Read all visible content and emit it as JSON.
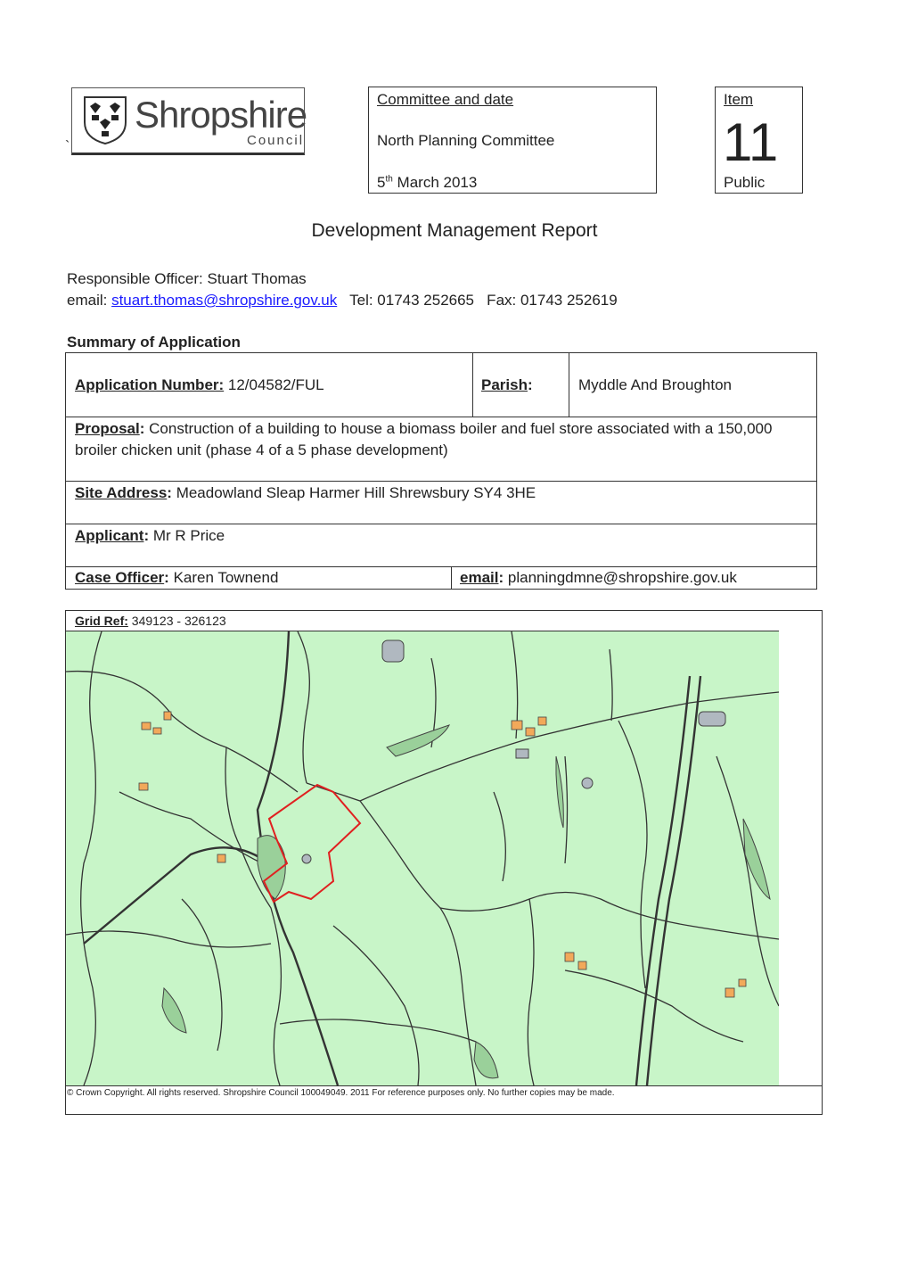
{
  "header": {
    "logo_word": "Shropshire",
    "logo_sub": "Council",
    "backtick": "`",
    "committee_label": "Committee and date",
    "committee_name": "North Planning Committee",
    "date_day": "5",
    "date_suffix": "th",
    "date_rest": " March 2013",
    "item_label": "Item",
    "item_number": "11",
    "item_status": "Public"
  },
  "report_title": "Development Management Report",
  "officer": {
    "line": "Responsible Officer: Stuart Thomas",
    "email_prefix": "email: ",
    "email": "stuart.thomas@shropshire.gov.uk",
    "phones": "   Tel: 01743 252665   Fax: 01743 252619"
  },
  "summary_heading": "Summary of Application",
  "application": {
    "number_label": "Application Number:",
    "number_value": " 12/04582/FUL",
    "parish_label": "Parish",
    "parish_colon": ":",
    "parish_value": "Myddle And Broughton",
    "proposal_label": "Proposal",
    "proposal_colon": ":",
    "proposal_value": " Construction of a building to house a biomass boiler and fuel store associated with a 150,000 broiler chicken unit (phase 4 of a 5 phase development)",
    "site_label": "Site Address",
    "site_colon": ":",
    "site_value": " Meadowland  Sleap Harmer Hill Shrewsbury SY4 3HE",
    "applicant_label": "Applicant",
    "applicant_colon": ":",
    "applicant_value": " Mr R Price",
    "case_label": "Case Officer",
    "case_colon": ":",
    "case_value": " Karen Townend",
    "email_label": "email",
    "email_colon": ":",
    "email_value": " planningdmne@shropshire.gov.uk"
  },
  "map": {
    "gridref_label": "Grid Ref:",
    "gridref_value": " 349123 - 326123",
    "copyright": "© Crown Copyright. All rights reserved.  Shropshire Council 100049049. 2011 For reference purposes only. No further copies may be made.",
    "land_color": "#c8f5c8",
    "boundary_color": "#e02020"
  }
}
